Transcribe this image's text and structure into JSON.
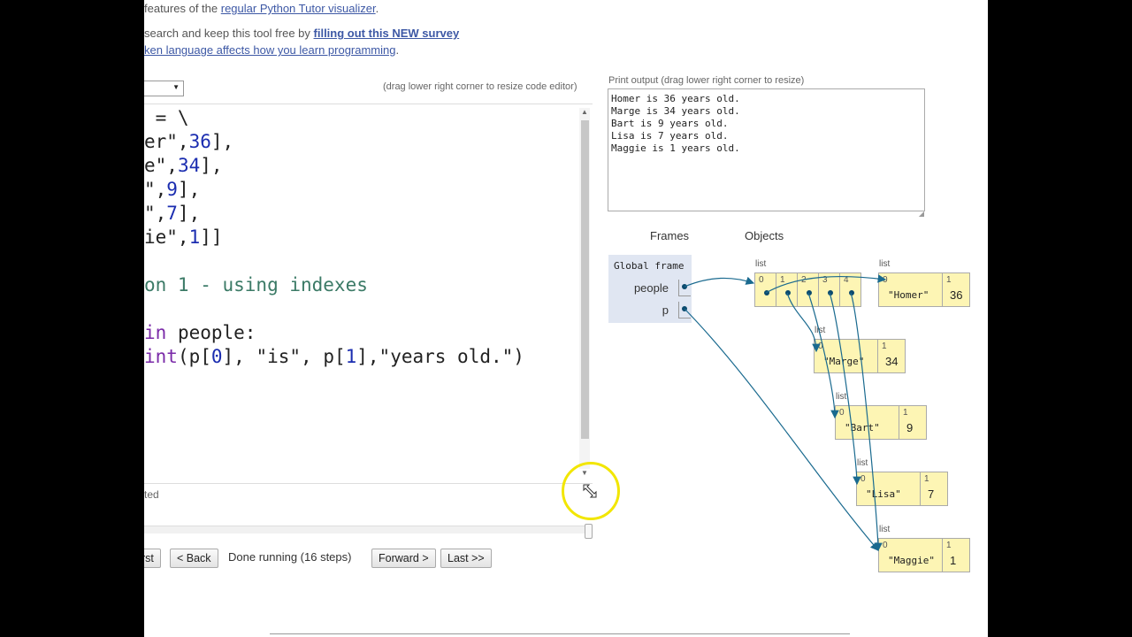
{
  "header": {
    "line1_prefix": " features of the ",
    "line1_link": "regular Python Tutor visualizer",
    "line1_suffix": ".",
    "line2_prefix": "search and keep this tool free by ",
    "line2_link": "filling out this NEW survey",
    "line3_link": "ken language affects how you learn programming",
    "line3_suffix": "."
  },
  "editor": {
    "drag_hint": "(drag lower right corner to resize code editor)",
    "lines": [
      {
        "parts": [
          {
            "t": " = \\",
            "c": ""
          }
        ]
      },
      {
        "parts": [
          {
            "t": "er\",",
            "c": ""
          },
          {
            "t": "36",
            "c": "num"
          },
          {
            "t": "],",
            "c": ""
          }
        ]
      },
      {
        "parts": [
          {
            "t": "e\",",
            "c": ""
          },
          {
            "t": "34",
            "c": "num"
          },
          {
            "t": "],",
            "c": ""
          }
        ]
      },
      {
        "parts": [
          {
            "t": "\",",
            "c": ""
          },
          {
            "t": "9",
            "c": "num"
          },
          {
            "t": "],",
            "c": ""
          }
        ]
      },
      {
        "parts": [
          {
            "t": "\",",
            "c": ""
          },
          {
            "t": "7",
            "c": "num"
          },
          {
            "t": "],",
            "c": ""
          }
        ]
      },
      {
        "parts": [
          {
            "t": "ie\",",
            "c": ""
          },
          {
            "t": "1",
            "c": "num"
          },
          {
            "t": "]]",
            "c": ""
          }
        ]
      },
      {
        "parts": []
      },
      {
        "parts": [
          {
            "t": "on 1 - using indexes",
            "c": "cmt"
          }
        ]
      },
      {
        "parts": []
      },
      {
        "parts": [
          {
            "t": "in",
            "c": "kw"
          },
          {
            "t": " people:",
            "c": ""
          }
        ]
      },
      {
        "parts": [
          {
            "t": "int",
            "c": "fn"
          },
          {
            "t": "(p[",
            "c": ""
          },
          {
            "t": "0",
            "c": "num"
          },
          {
            "t": "], \"is\", p[",
            "c": ""
          },
          {
            "t": "1",
            "c": "num"
          },
          {
            "t": "],\"years old.\")",
            "c": ""
          }
        ]
      }
    ],
    "status_text": "ted"
  },
  "controls": {
    "first_label": "rst",
    "back_label": "< Back",
    "status": "Done running (16 steps)",
    "forward_label": "Forward >",
    "last_label": "Last >>"
  },
  "print_output": {
    "label": "Print output (drag lower right corner to resize)",
    "lines": [
      "Homer is 36 years old.",
      "Marge is 34 years old.",
      "Bart is 9 years old.",
      "Lisa is 7 years old.",
      "Maggie is 1 years old."
    ]
  },
  "viz": {
    "frames_header": "Frames",
    "objects_header": "Objects",
    "global_frame_title": "Global frame",
    "variables": [
      {
        "name": "people"
      },
      {
        "name": "p"
      }
    ],
    "people_list": {
      "type_label": "list",
      "indices": [
        "0",
        "1",
        "2",
        "3",
        "4"
      ]
    },
    "sublists": [
      {
        "type_label": "list",
        "idx0": "0",
        "idx1": "1",
        "name": "\"Homer\"",
        "age": "36"
      },
      {
        "type_label": "list",
        "idx0": "0",
        "idx1": "1",
        "name": "\"Marge\"",
        "age": "34"
      },
      {
        "type_label": "list",
        "idx0": "0",
        "idx1": "1",
        "name": "\"Bart\"",
        "age": "9"
      },
      {
        "type_label": "list",
        "idx0": "0",
        "idx1": "1",
        "name": "\"Lisa\"",
        "age": "7"
      },
      {
        "type_label": "list",
        "idx0": "0",
        "idx1": "1",
        "name": "\"Maggie\"",
        "age": "1"
      }
    ]
  },
  "colors": {
    "arrow": "#1a6a8f",
    "heap_bg": "#fdf5b4",
    "frame_bg": "#e0e6f2",
    "cursor_ring": "#f2e600"
  }
}
